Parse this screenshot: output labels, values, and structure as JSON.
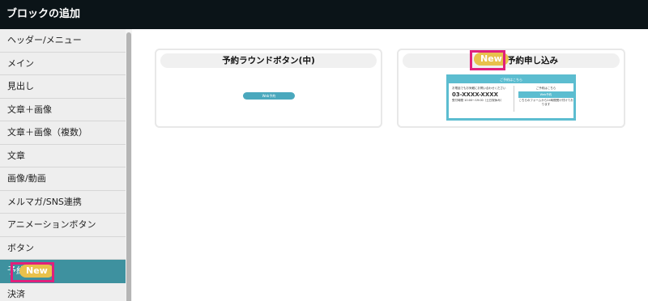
{
  "titlebar": {
    "title": "ブロックの追加"
  },
  "sidebar": {
    "items": [
      {
        "label": "ヘッダー/メニュー"
      },
      {
        "label": "メイン"
      },
      {
        "label": "見出し"
      },
      {
        "label": "文章＋画像"
      },
      {
        "label": "文章＋画像（複数）"
      },
      {
        "label": "文章"
      },
      {
        "label": "画像/動画"
      },
      {
        "label": "メルマガ/SNS連携"
      },
      {
        "label": "アニメーションボタン"
      },
      {
        "label": "ボタン"
      },
      {
        "label": "予約",
        "badge": "New",
        "active": true
      },
      {
        "label": "決済"
      }
    ]
  },
  "cards": [
    {
      "title": "予約ラウンドボタン(中)",
      "preview": {
        "button_label": "Web予約"
      }
    },
    {
      "title": "予約申し込み",
      "badge": "New",
      "preview": {
        "header": "ご予約はこちら",
        "left_title": "お電話でもお気軽にお問い合わせください",
        "phone": "03-XXXX-XXXX",
        "left_hours": "受付時間 10:00〜19:00（土日祝休み）",
        "right_title": "ご予約はこちら",
        "button_label": "Web予約",
        "right_note": "こちらのフォームから24時間受け付けております"
      }
    }
  ],
  "colors": {
    "titlebar": "#0b1418",
    "active": "#3e919f",
    "badge": "#e8c14c",
    "highlight": "#e0207c",
    "preview_accent": "#5cbdd0"
  }
}
